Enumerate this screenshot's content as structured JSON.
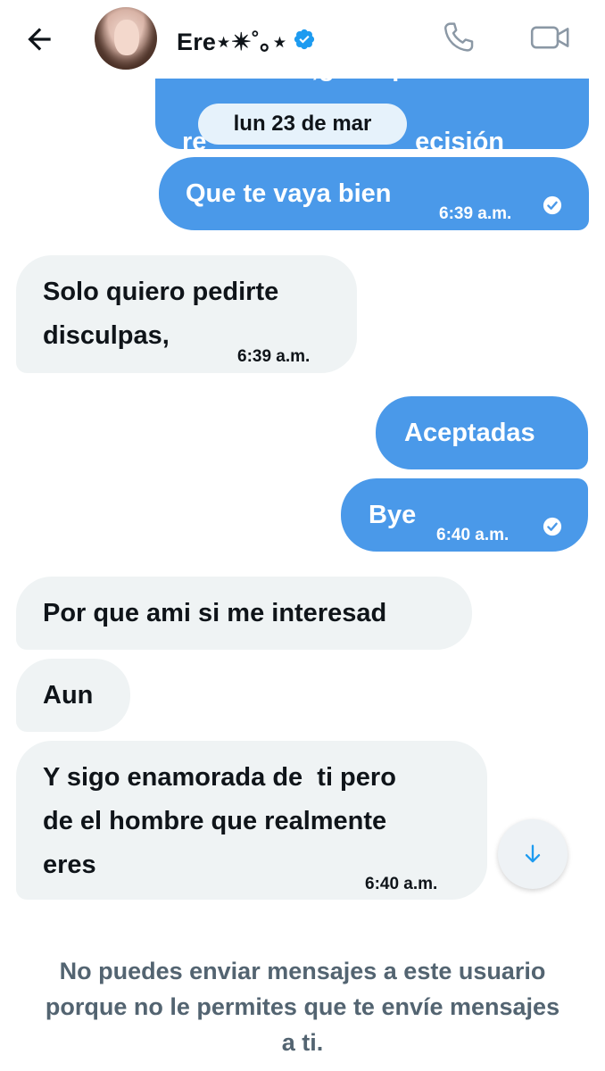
{
  "header": {
    "contact_name": "Ere⋆✴︎˚｡⋆",
    "back_icon": "arrow-left-icon",
    "verified_icon": "verified-badge-icon",
    "call_icon": "phone-icon",
    "video_icon": "video-camera-icon"
  },
  "colors": {
    "outgoing_bubble": "#4a99e9",
    "incoming_bubble": "#eff3f4",
    "date_pill": "#e6f2fb",
    "footer_text": "#536471"
  },
  "date_separator": "lun 23 de mar",
  "cut_message": {
    "line1": "                  ,g        p",
    "line2": "re                             ecisión"
  },
  "messages": [
    {
      "direction": "out",
      "text": "Que te vaya bien",
      "time": "6:39 a.m.",
      "read": true
    },
    {
      "direction": "in",
      "text_line1": "Solo quiero pedirte",
      "text_line2": "disculpas,",
      "time": "6:39 a.m."
    },
    {
      "direction": "out",
      "text": "Aceptadas"
    },
    {
      "direction": "out",
      "text": "Bye",
      "time": "6:40 a.m.",
      "read": true
    },
    {
      "direction": "in",
      "text": "Por que ami si me interesad"
    },
    {
      "direction": "in",
      "text": "Aun"
    },
    {
      "direction": "in",
      "text_line1": "Y sigo enamorada de  ti pero",
      "text_line2": "de el hombre que realmente",
      "text_line3": "eres",
      "time": "6:40 a.m."
    }
  ],
  "scroll_button_icon": "arrow-down-icon",
  "footer_notice": "No puedes enviar mensajes a este usuario porque no le permites que te envíe mensajes a ti."
}
